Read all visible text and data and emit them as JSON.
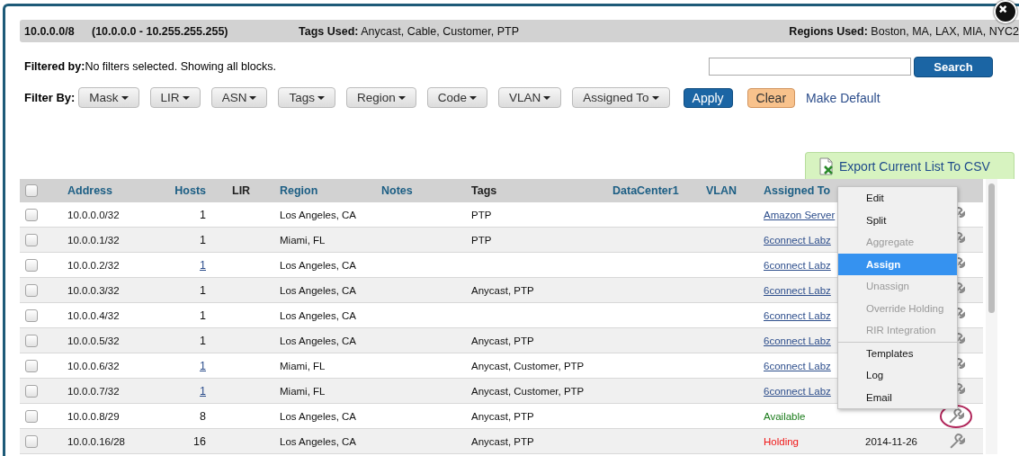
{
  "summary": {
    "block": "10.0.0.0/8",
    "range": "(10.0.0.0 - 10.255.255.255)",
    "tags_used": "**Tags Used:** Anycast, Cable, Customer, PTP",
    "regions_used": "**Regions Used:** Boston, MA, LAX, MIA, NYC2"
  },
  "filter_status": "**Filtered by:**No filters selected. Showing all blocks.",
  "search": {
    "button": "Search"
  },
  "filter_bar": {
    "label": "Filter By:",
    "dropdowns": [
      "Mask",
      "LIR",
      "ASN",
      "Tags",
      "Region",
      "Code",
      "VLAN",
      "Assigned To"
    ],
    "apply": "Apply",
    "clear": "Clear",
    "make_default": "Make Default"
  },
  "export_button": "Export Current List To CSV",
  "table": {
    "select_all_checked": false,
    "columns": [
      {
        "label": "Address",
        "sortable": true
      },
      {
        "label": "Hosts",
        "sortable": true
      },
      {
        "label": "LIR",
        "sortable": false
      },
      {
        "label": "Region",
        "sortable": true
      },
      {
        "label": "Notes",
        "sortable": true
      },
      {
        "label": "Tags",
        "sortable": false
      },
      {
        "label": "DataCenter1",
        "sortable": true
      },
      {
        "label": "VLAN",
        "sortable": true
      },
      {
        "label": "Assigned To",
        "sortable": true
      }
    ],
    "rows": [
      {
        "checked": false,
        "address": "10.0.0.0/32",
        "hosts": "1",
        "hosts_link": false,
        "region": "Los Angeles, CA",
        "tags": "PTP",
        "assigned": {
          "kind": "link",
          "text": "Amazon Server"
        },
        "highlighted": false
      },
      {
        "checked": false,
        "address": "10.0.0.1/32",
        "hosts": "1",
        "hosts_link": false,
        "region": "Miami, FL",
        "tags": "PTP",
        "assigned": {
          "kind": "link",
          "text": "6connect Labz"
        },
        "highlighted": false
      },
      {
        "checked": false,
        "address": "10.0.0.2/32",
        "hosts": "1",
        "hosts_link": true,
        "region": "Los Angeles, CA",
        "assigned": {
          "kind": "link",
          "text": "6connect Labz"
        },
        "highlighted": false
      },
      {
        "checked": false,
        "address": "10.0.0.3/32",
        "hosts": "1",
        "hosts_link": false,
        "region": "Los Angeles, CA",
        "tags": "Anycast, PTP",
        "assigned": {
          "kind": "link",
          "text": "6connect Labz"
        },
        "highlighted": false
      },
      {
        "checked": false,
        "address": "10.0.0.4/32",
        "hosts": "1",
        "hosts_link": false,
        "region": "Los Angeles, CA",
        "assigned": {
          "kind": "link",
          "text": "6connect Labz"
        },
        "highlighted": false
      },
      {
        "checked": false,
        "address": "10.0.0.5/32",
        "hosts": "1",
        "hosts_link": false,
        "region": "Los Angeles, CA",
        "tags": "Anycast, PTP",
        "assigned": {
          "kind": "link",
          "text": "6connect Labz"
        },
        "highlighted": false
      },
      {
        "checked": false,
        "address": "10.0.0.6/32",
        "hosts": "1",
        "hosts_link": true,
        "region": "Miami, FL",
        "tags": "Anycast, Customer, PTP",
        "assigned": {
          "kind": "link",
          "text": "6connect Labz"
        },
        "highlighted": false
      },
      {
        "checked": false,
        "address": "10.0.0.7/32",
        "hosts": "1",
        "hosts_link": true,
        "region": "Miami, FL",
        "tags": "Anycast, Customer, PTP",
        "assigned": {
          "kind": "link",
          "text": "6connect Labz"
        },
        "highlighted": false
      },
      {
        "checked": false,
        "address": "10.0.0.8/29",
        "hosts": "8",
        "hosts_link": false,
        "region": "Los Angeles, CA",
        "tags": "Anycast, PTP",
        "assigned": {
          "kind": "available",
          "text": "Available"
        },
        "highlighted": true
      },
      {
        "checked": false,
        "address": "10.0.0.16/28",
        "hosts": "16",
        "hosts_link": false,
        "region": "Los Angeles, CA",
        "tags": "Anycast, PTP",
        "assigned": {
          "kind": "holding",
          "text": "Holding"
        },
        "updated": "2014-11-26",
        "highlighted": false
      }
    ]
  },
  "context_menu": [
    {
      "label": "Edit",
      "disabled": false,
      "selected": false
    },
    {
      "label": "Split",
      "disabled": false,
      "selected": false
    },
    {
      "label": "Aggregate",
      "disabled": true,
      "selected": false
    },
    {
      "label": "Assign",
      "disabled": false,
      "selected": true
    },
    {
      "label": "Unassign",
      "disabled": true,
      "selected": false
    },
    {
      "label": "Override Holding",
      "disabled": true,
      "selected": false
    },
    {
      "label": "RIR Integration",
      "disabled": true,
      "selected": false,
      "divider_after": true
    },
    {
      "label": "Templates",
      "disabled": false,
      "selected": false
    },
    {
      "label": "Log",
      "disabled": false,
      "selected": false
    },
    {
      "label": "Email",
      "disabled": false,
      "selected": false
    }
  ]
}
